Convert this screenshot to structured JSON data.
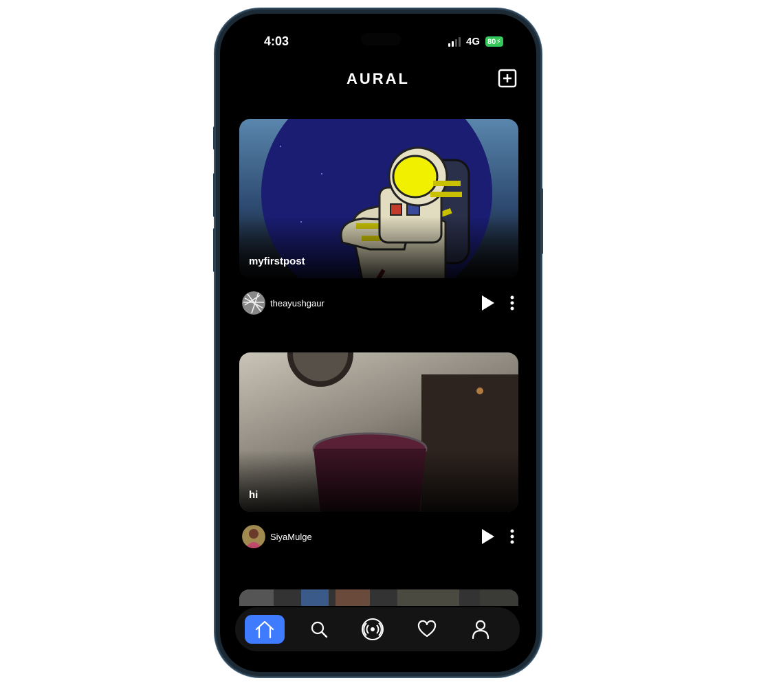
{
  "status_bar": {
    "time": "4:03",
    "network": "4G",
    "battery": "80"
  },
  "app": {
    "title": "AURAL",
    "add_icon": "plus-square-icon"
  },
  "feed": [
    {
      "title": "myfirstpost",
      "username": "theayushgaur",
      "image": "astronaut-illustration"
    },
    {
      "title": "hi",
      "username": "SiyaMulge",
      "image": "juice-glass-photo"
    }
  ],
  "nav": {
    "active": "home",
    "tabs": [
      {
        "id": "home",
        "icon": "home-icon"
      },
      {
        "id": "search",
        "icon": "search-icon"
      },
      {
        "id": "broadcast",
        "icon": "broadcast-icon"
      },
      {
        "id": "likes",
        "icon": "heart-icon"
      },
      {
        "id": "profile",
        "icon": "user-icon"
      }
    ]
  },
  "colors": {
    "accent": "#3f7bff",
    "background": "#000000",
    "battery": "#34c759"
  }
}
